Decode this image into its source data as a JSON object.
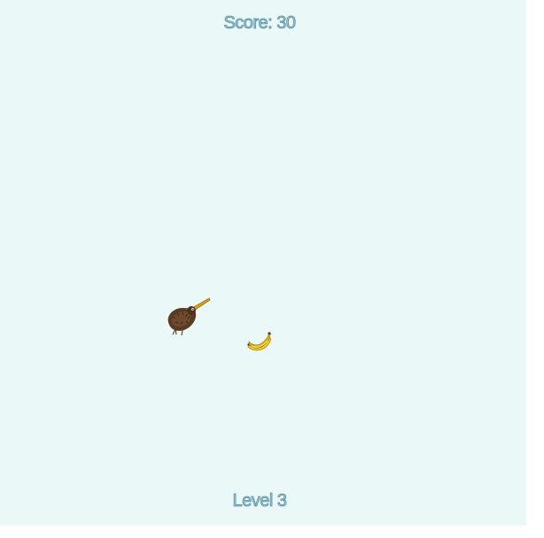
{
  "hud": {
    "score_label": "Score: 30",
    "level_label": "Level 3"
  },
  "entities": {
    "player": {
      "icon": "kiwi-bird-icon"
    },
    "pickup": {
      "icon": "banana-icon"
    }
  },
  "colors": {
    "background": "#eaf9f7",
    "hud_text_fill": "#9fcbd6",
    "hud_text_outline": "#5b8ea3"
  }
}
